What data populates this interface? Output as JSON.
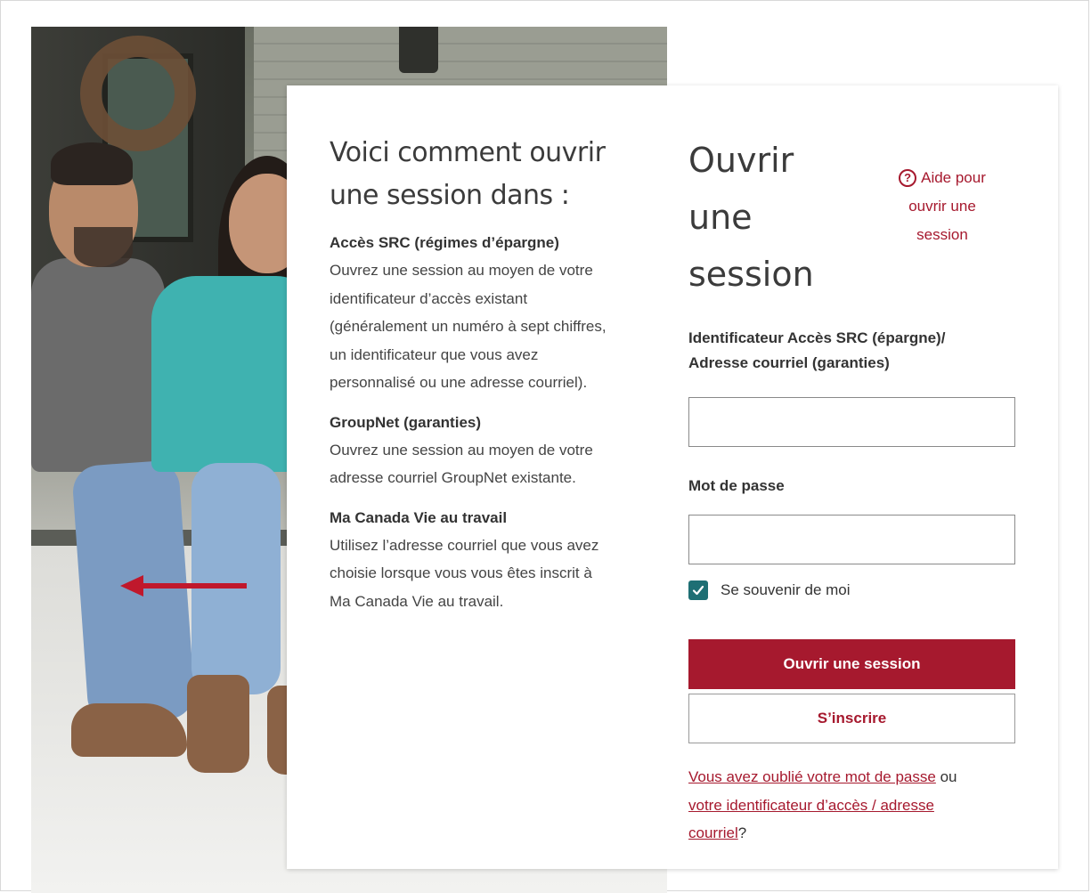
{
  "colors": {
    "brand_red": "#a6192e",
    "checkbox_teal": "#1e6f74",
    "text_dark": "#333333",
    "card_bg": "#ffffff"
  },
  "info": {
    "title_line1": "Voici comment ouvrir",
    "title_line2": "une session dans :",
    "sections": [
      {
        "heading": "Accès SRC (régimes d’épargne)",
        "lines": [
          "Ouvrez une session au moyen de votre",
          "identificateur d’accès existant",
          "(généralement un numéro à sept chiffres,",
          "un identificateur que vous avez",
          "personnalisé ou une adresse courriel)."
        ]
      },
      {
        "heading": "GroupNet (garanties)",
        "lines": [
          "Ouvrez une session au moyen de votre",
          "adresse courriel GroupNet existante."
        ]
      },
      {
        "heading": "Ma Canada Vie au travail",
        "lines": [
          "Utilisez l’adresse courriel que vous avez",
          "choisie lorsque vous vous êtes inscrit à",
          "Ma Canada Vie au travail."
        ]
      }
    ]
  },
  "login": {
    "title_lines": [
      "Ouvrir",
      "une",
      "session"
    ],
    "help": {
      "icon": "question-circle-icon",
      "icon_glyph": "?",
      "lines": [
        "Aide pour",
        "ouvrir une",
        "session"
      ]
    },
    "id_label_line1": "Identificateur Accès SRC (épargne)/",
    "id_label_line2": "Adresse courriel (garanties)",
    "id_value": "",
    "password_label": "Mot de passe",
    "password_value": "",
    "remember_label": "Se souvenir de moi",
    "remember_checked": true,
    "submit_label": "Ouvrir une session",
    "register_label": "S’inscrire",
    "forgot": {
      "link1": "Vous avez oublié votre mot de passe",
      "connector": " ou ",
      "link2_line1": "votre identificateur d’accès / adresse",
      "link2_line2": "courriel",
      "suffix": "?"
    }
  },
  "annotation": {
    "icon": "left-arrow-icon",
    "color": "#c0182c"
  }
}
